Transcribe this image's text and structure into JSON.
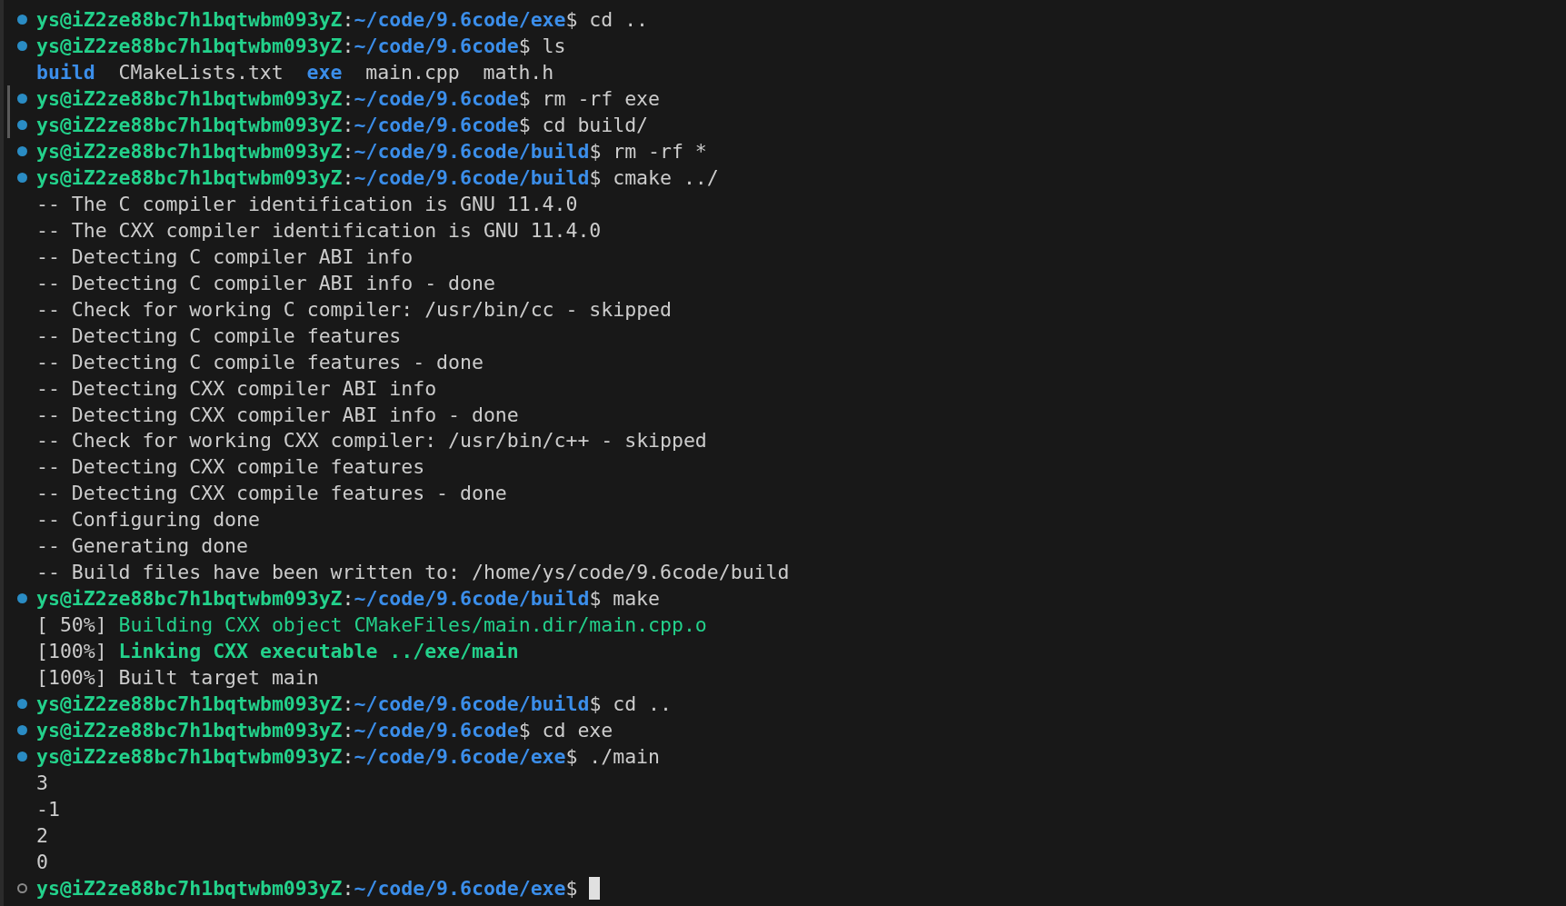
{
  "terminal": {
    "lines": [
      {
        "kind": "prompt",
        "completed": true,
        "marked": false,
        "user": "ys@iZ2ze88bc7h1bqtwbm093yZ",
        "sep": ":",
        "path": "~/code/9.6code/exe",
        "sigil": "$",
        "command": "cd .."
      },
      {
        "kind": "prompt",
        "completed": true,
        "marked": false,
        "user": "ys@iZ2ze88bc7h1bqtwbm093yZ",
        "sep": ":",
        "path": "~/code/9.6code",
        "sigil": "$",
        "command": "ls"
      },
      {
        "kind": "listing",
        "items": [
          {
            "name": "build",
            "kind": "dir"
          },
          {
            "name": "CMakeLists.txt",
            "kind": "file"
          },
          {
            "name": "exe",
            "kind": "dir"
          },
          {
            "name": "main.cpp",
            "kind": "file"
          },
          {
            "name": "math.h",
            "kind": "file"
          }
        ]
      },
      {
        "kind": "prompt",
        "completed": true,
        "marked": true,
        "user": "ys@iZ2ze88bc7h1bqtwbm093yZ",
        "sep": ":",
        "path": "~/code/9.6code",
        "sigil": "$",
        "command": "rm -rf exe"
      },
      {
        "kind": "prompt",
        "completed": true,
        "marked": true,
        "user": "ys@iZ2ze88bc7h1bqtwbm093yZ",
        "sep": ":",
        "path": "~/code/9.6code",
        "sigil": "$",
        "command": "cd build/"
      },
      {
        "kind": "prompt",
        "completed": true,
        "marked": false,
        "user": "ys@iZ2ze88bc7h1bqtwbm093yZ",
        "sep": ":",
        "path": "~/code/9.6code/build",
        "sigil": "$",
        "command": "rm -rf *"
      },
      {
        "kind": "prompt",
        "completed": true,
        "marked": false,
        "user": "ys@iZ2ze88bc7h1bqtwbm093yZ",
        "sep": ":",
        "path": "~/code/9.6code/build",
        "sigil": "$",
        "command": "cmake ../"
      },
      {
        "kind": "output",
        "segments": [
          {
            "text": "-- The C compiler identification is GNU 11.4.0",
            "kind": "plain"
          }
        ]
      },
      {
        "kind": "output",
        "segments": [
          {
            "text": "-- The CXX compiler identification is GNU 11.4.0",
            "kind": "plain"
          }
        ]
      },
      {
        "kind": "output",
        "segments": [
          {
            "text": "-- Detecting C compiler ABI info",
            "kind": "plain"
          }
        ]
      },
      {
        "kind": "output",
        "segments": [
          {
            "text": "-- Detecting C compiler ABI info - done",
            "kind": "plain"
          }
        ]
      },
      {
        "kind": "output",
        "segments": [
          {
            "text": "-- Check for working C compiler: /usr/bin/cc - skipped",
            "kind": "plain"
          }
        ]
      },
      {
        "kind": "output",
        "segments": [
          {
            "text": "-- Detecting C compile features",
            "kind": "plain"
          }
        ]
      },
      {
        "kind": "output",
        "segments": [
          {
            "text": "-- Detecting C compile features - done",
            "kind": "plain"
          }
        ]
      },
      {
        "kind": "output",
        "segments": [
          {
            "text": "-- Detecting CXX compiler ABI info",
            "kind": "plain"
          }
        ]
      },
      {
        "kind": "output",
        "segments": [
          {
            "text": "-- Detecting CXX compiler ABI info - done",
            "kind": "plain"
          }
        ]
      },
      {
        "kind": "output",
        "segments": [
          {
            "text": "-- Check for working CXX compiler: /usr/bin/c++ - skipped",
            "kind": "plain"
          }
        ]
      },
      {
        "kind": "output",
        "segments": [
          {
            "text": "-- Detecting CXX compile features",
            "kind": "plain"
          }
        ]
      },
      {
        "kind": "output",
        "segments": [
          {
            "text": "-- Detecting CXX compile features - done",
            "kind": "plain"
          }
        ]
      },
      {
        "kind": "output",
        "segments": [
          {
            "text": "-- Configuring done",
            "kind": "plain"
          }
        ]
      },
      {
        "kind": "output",
        "segments": [
          {
            "text": "-- Generating done",
            "kind": "plain"
          }
        ]
      },
      {
        "kind": "output",
        "segments": [
          {
            "text": "-- Build files have been written to: /home/ys/code/9.6code/build",
            "kind": "plain"
          }
        ]
      },
      {
        "kind": "prompt",
        "completed": true,
        "marked": false,
        "user": "ys@iZ2ze88bc7h1bqtwbm093yZ",
        "sep": ":",
        "path": "~/code/9.6code/build",
        "sigil": "$",
        "command": "make"
      },
      {
        "kind": "output",
        "segments": [
          {
            "text": "[ 50%] ",
            "kind": "plain"
          },
          {
            "text": "Building CXX object CMakeFiles/main.dir/main.cpp.o",
            "kind": "green"
          }
        ]
      },
      {
        "kind": "output",
        "segments": [
          {
            "text": "[100%] ",
            "kind": "plain"
          },
          {
            "text": "Linking CXX executable ../exe/main",
            "kind": "bold"
          }
        ]
      },
      {
        "kind": "output",
        "segments": [
          {
            "text": "[100%] Built target main",
            "kind": "plain"
          }
        ]
      },
      {
        "kind": "prompt",
        "completed": true,
        "marked": false,
        "user": "ys@iZ2ze88bc7h1bqtwbm093yZ",
        "sep": ":",
        "path": "~/code/9.6code/build",
        "sigil": "$",
        "command": "cd .."
      },
      {
        "kind": "prompt",
        "completed": true,
        "marked": false,
        "user": "ys@iZ2ze88bc7h1bqtwbm093yZ",
        "sep": ":",
        "path": "~/code/9.6code",
        "sigil": "$",
        "command": "cd exe"
      },
      {
        "kind": "prompt",
        "completed": true,
        "marked": false,
        "user": "ys@iZ2ze88bc7h1bqtwbm093yZ",
        "sep": ":",
        "path": "~/code/9.6code/exe",
        "sigil": "$",
        "command": "./main"
      },
      {
        "kind": "output",
        "segments": [
          {
            "text": "3",
            "kind": "plain"
          }
        ]
      },
      {
        "kind": "output",
        "segments": [
          {
            "text": "-1",
            "kind": "plain"
          }
        ]
      },
      {
        "kind": "output",
        "segments": [
          {
            "text": "2",
            "kind": "plain"
          }
        ]
      },
      {
        "kind": "output",
        "segments": [
          {
            "text": "0",
            "kind": "plain"
          }
        ]
      },
      {
        "kind": "prompt",
        "completed": false,
        "marked": false,
        "cursor": true,
        "user": "ys@iZ2ze88bc7h1bqtwbm093yZ",
        "sep": ":",
        "path": "~/code/9.6code/exe",
        "sigil": "$"
      }
    ]
  }
}
